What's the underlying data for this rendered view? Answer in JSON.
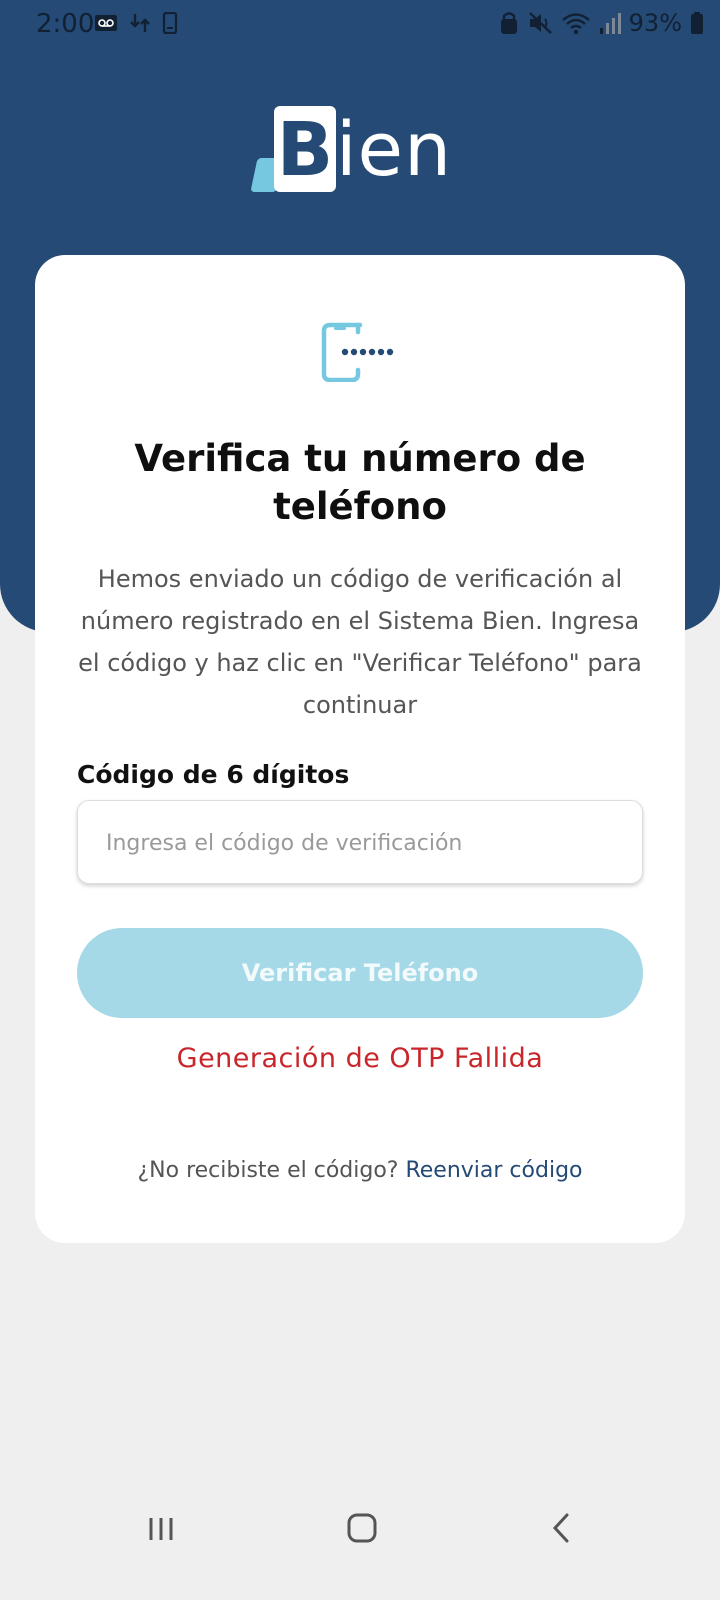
{
  "status_bar": {
    "time": "2:00",
    "battery": "93%",
    "left_icons": [
      "voicemail-icon",
      "data-transfer-icon",
      "phone-device-icon"
    ],
    "right_icons": [
      "alarm-lock-icon",
      "mute-icon",
      "wifi-icon",
      "signal-icon",
      "battery-icon"
    ]
  },
  "logo": {
    "text": "ien",
    "letter": "B"
  },
  "card": {
    "icon": "phone-otp-icon",
    "title": "Verifica tu número de teléfono",
    "description": "Hemos enviado un código de verificación al número registrado en el Sistema Bien. Ingresa el código y haz clic en \"Verificar Teléfono\" para continuar",
    "field_label": "Código de 6 dígitos",
    "input_value": "",
    "input_placeholder": "Ingresa el código de verificación",
    "verify_button": "Verificar Teléfono",
    "error_message": "Generación de OTP Fallida",
    "resend_prompt": "¿No recibiste el código?",
    "resend_link": "Reenviar código"
  },
  "colors": {
    "header": "#254a75",
    "accent": "#76c8e1",
    "button_disabled": "#a5d9e7",
    "error": "#c8262a"
  },
  "nav_bar": {
    "items": [
      "recent-apps-icon",
      "home-icon",
      "back-icon"
    ]
  }
}
